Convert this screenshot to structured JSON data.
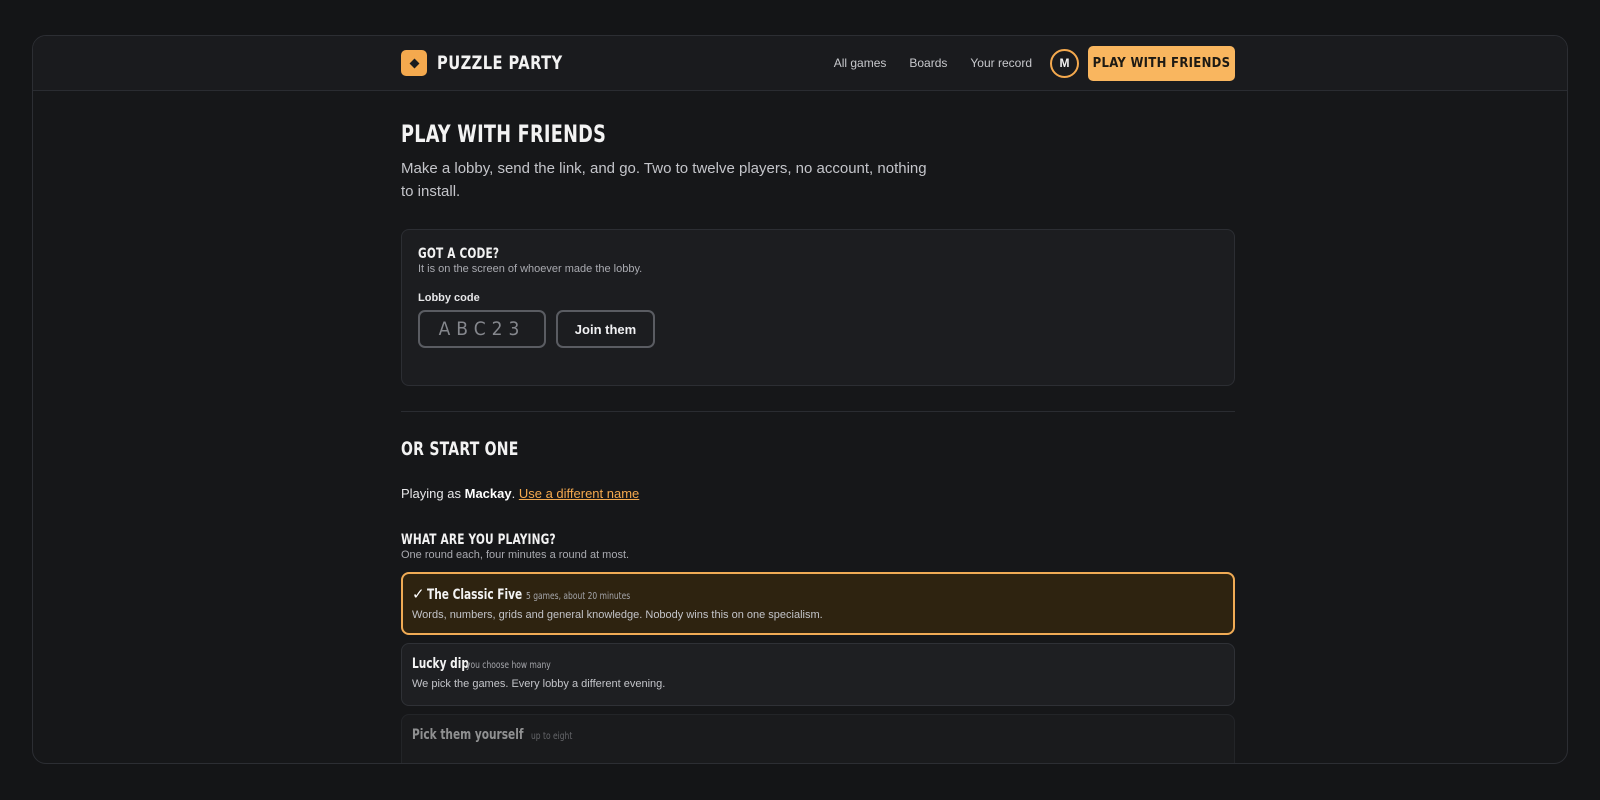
{
  "brand": {
    "name": "PUZZLE PARTY",
    "accent": "#f9b65f"
  },
  "nav": {
    "items": [
      "All games",
      "Boards",
      "Your record"
    ],
    "avatar_initial": "M",
    "cta_label": "PLAY WITH FRIENDS"
  },
  "page": {
    "title": "PLAY WITH FRIENDS",
    "lede": "Make a lobby, send the link, and go. Two to twelve players, no account, nothing to install."
  },
  "join_card": {
    "title": "GOT A CODE?",
    "subtitle": "It is on the screen of whoever made the lobby.",
    "field_label": "Lobby code",
    "field_placeholder": "ABC23",
    "field_value": "",
    "join_label": "Join them"
  },
  "start": {
    "title": "OR START ONE",
    "playing_prefix": "Playing as",
    "player_name": "Mackay",
    "playing_suffix": ".",
    "change_name_link": "Use a different name"
  },
  "choices": {
    "title": "WHAT ARE YOU PLAYING?",
    "subtitle": "One round each, four minutes a round at most.",
    "options": [
      {
        "check": "✓",
        "title": "The Classic Five",
        "meta": "5 games, about 20 minutes",
        "desc": "Words, numbers, grids and general knowledge. Nobody wins this on one specialism.",
        "selected": true
      },
      {
        "title": "Lucky dip",
        "meta": "you choose how many",
        "desc": "We pick the games. Every lobby a different evening.",
        "selected": false
      },
      {
        "title": "Pick them yourself",
        "meta": "up to eight",
        "desc": "",
        "selected": false
      }
    ]
  }
}
